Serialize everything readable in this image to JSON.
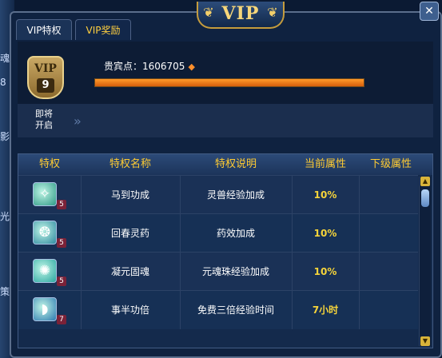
{
  "background_glyphs": [
    "魂",
    "8",
    "影",
    "光",
    "策"
  ],
  "window": {
    "title": "VIP",
    "close_glyph": "✕"
  },
  "tabs": [
    {
      "label": "VIP特权",
      "active": true
    },
    {
      "label": "VIP奖励",
      "active": false
    }
  ],
  "vip": {
    "badge_text": "VIP",
    "level": "9",
    "points_label": "贵宾点：1606705",
    "progress_fraction": 1.0
  },
  "soon": {
    "label_line1": "即将",
    "label_line2": "开启",
    "arrow": "»"
  },
  "table": {
    "headers": [
      "特权",
      "特权名称",
      "特权说明",
      "当前属性",
      "下级属性"
    ],
    "rows": [
      {
        "icon": "horse-skill-icon",
        "glyph": "✧",
        "color": "#2f9a86",
        "level": "5",
        "name": "马到功成",
        "desc": "灵兽经验加成",
        "current": "10%",
        "next": ""
      },
      {
        "icon": "spring-skill-icon",
        "glyph": "❂",
        "color": "#2f8aa0",
        "level": "5",
        "name": "回春灵药",
        "desc": "药效加成",
        "current": "10%",
        "next": ""
      },
      {
        "icon": "sun-skill-icon",
        "glyph": "✺",
        "color": "#2aa6a0",
        "level": "5",
        "name": "凝元固魂",
        "desc": "元魂珠经验加成",
        "current": "10%",
        "next": ""
      },
      {
        "icon": "wave-skill-icon",
        "glyph": "◗",
        "color": "#2d7ab0",
        "level": "7",
        "name": "事半功倍",
        "desc": "免费三倍经验时间",
        "current": "7小时",
        "next": ""
      }
    ]
  },
  "scrollbar": {
    "up": "▲",
    "down": "▼"
  },
  "colors": {
    "accent_gold": "#ffcc33",
    "value_yellow": "#f6d43a",
    "progress_orange": "#ff9a2a"
  }
}
